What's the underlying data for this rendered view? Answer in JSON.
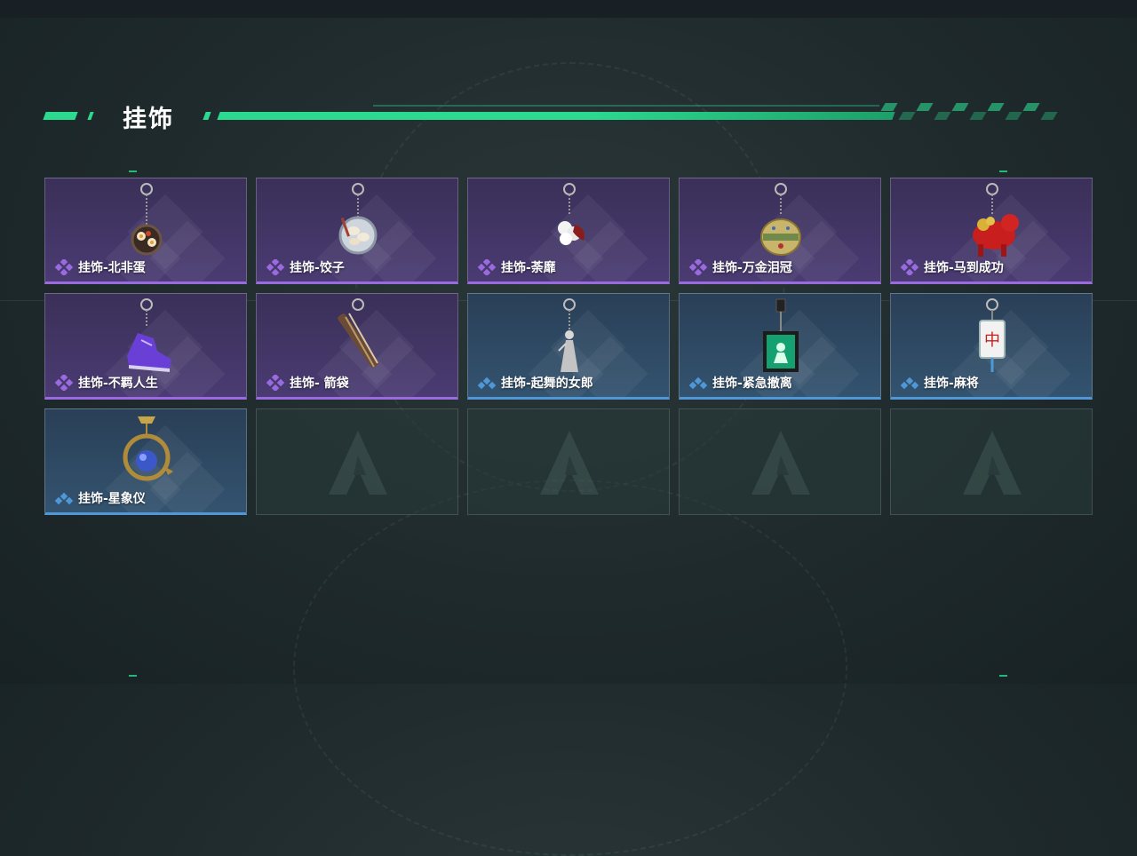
{
  "section": {
    "title": "挂饰"
  },
  "colors": {
    "accent": "#2bd98f",
    "epic": "#9a6be0",
    "rare": "#4f97d6"
  },
  "items": [
    {
      "name": "挂饰-北非蛋",
      "rarity": "epic",
      "icon": "shakshuka-pan-charm-icon"
    },
    {
      "name": "挂饰-饺子",
      "rarity": "epic",
      "icon": "dumpling-plate-charm-icon"
    },
    {
      "name": "挂饰-荼靡",
      "rarity": "epic",
      "icon": "flower-charm-icon"
    },
    {
      "name": "挂饰-万金泪冠",
      "rarity": "epic",
      "icon": "crown-charm-icon"
    },
    {
      "name": "挂饰-马到成功",
      "rarity": "epic",
      "icon": "red-horse-charm-icon"
    },
    {
      "name": "挂饰-不羁人生",
      "rarity": "epic",
      "icon": "sneaker-charm-icon"
    },
    {
      "name": "挂饰- 箭袋",
      "rarity": "epic",
      "icon": "quiver-charm-icon"
    },
    {
      "name": "挂饰-起舞的女郎",
      "rarity": "rare",
      "icon": "dancer-figurine-charm-icon"
    },
    {
      "name": "挂饰-紧急撤离",
      "rarity": "rare",
      "icon": "exit-sign-charm-icon"
    },
    {
      "name": "挂饰-麻将",
      "rarity": "rare",
      "icon": "mahjong-tile-charm-icon"
    },
    {
      "name": "挂饰-星象仪",
      "rarity": "rare",
      "icon": "astrolabe-charm-icon"
    }
  ],
  "empty_slots": 4
}
